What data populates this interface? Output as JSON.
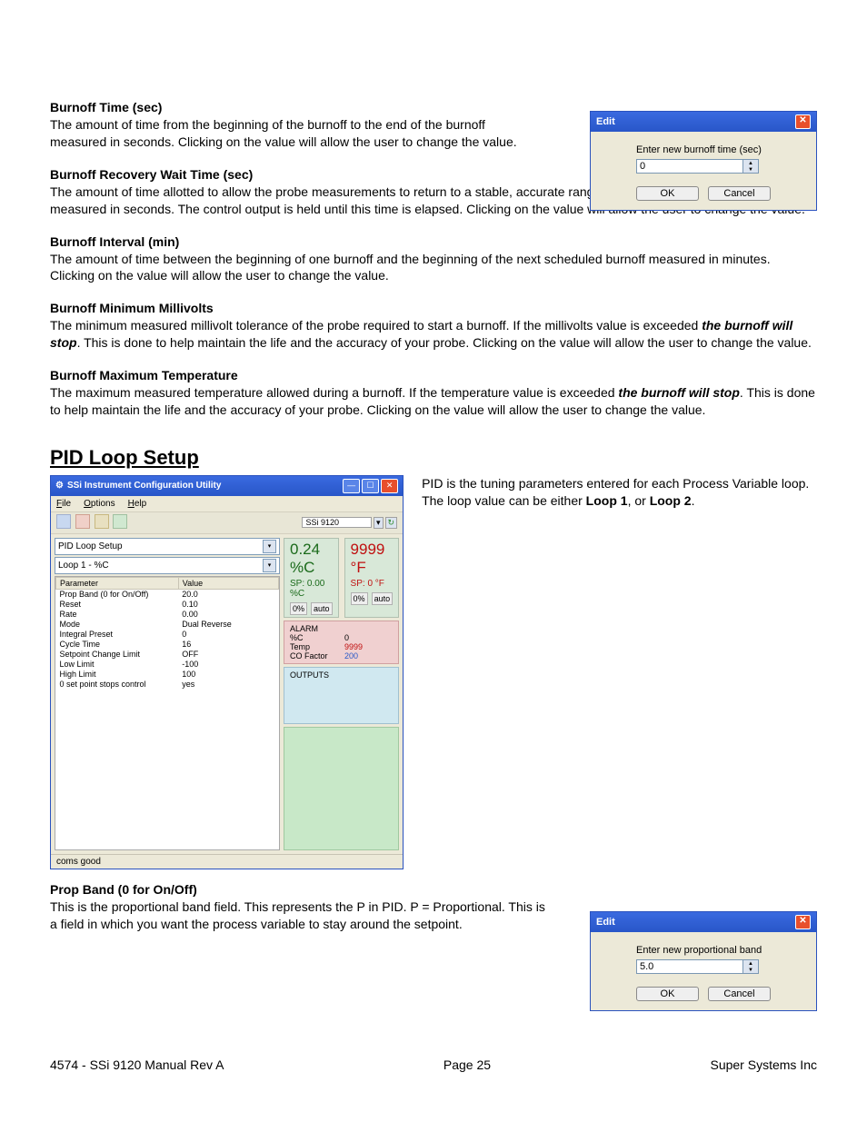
{
  "sections": {
    "burnoff_time": {
      "heading": "Burnoff Time (sec)",
      "text": "The amount of time from the beginning of the burnoff to the end of the burnoff measured in seconds.  Clicking on the value will allow the user to change the value."
    },
    "burnoff_recovery": {
      "heading": "Burnoff Recovery Wait Time (sec)",
      "text": "The amount of time allotted to allow the probe measurements to return to a stable, accurate range after the burnoff is complete. This is measured in seconds. The control output is held until this time is elapsed.  Clicking on the value will allow the user to change the value."
    },
    "burnoff_interval": {
      "heading": "Burnoff Interval (min)",
      "text": "The amount of time between the beginning of one burnoff and the beginning of the next scheduled burnoff measured in minutes.  Clicking on the value will allow the user to change the value."
    },
    "burnoff_min_mv": {
      "heading": "Burnoff Minimum Millivolts",
      "text_1": "The minimum measured millivolt tolerance of the probe required to start a burnoff.  If the millivolts value is exceeded ",
      "text_em": "the burnoff will stop",
      "text_2": ". This is done to help maintain the life and the accuracy of your probe.  Clicking on the value will allow the user to change the value."
    },
    "burnoff_max_temp": {
      "heading": "Burnoff Maximum Temperature",
      "text_1": "The maximum measured temperature allowed during a burnoff. If the temperature value is exceeded ",
      "text_em": "the burnoff will stop",
      "text_2": ". This is done to help maintain the life and the accuracy of your probe.  Clicking on the value will allow the user to change the value."
    },
    "pid_heading": "PID Loop Setup",
    "pid_side": {
      "text_1": "PID is the tuning parameters entered for each Process Variable loop.  The loop value can be either ",
      "loop1": "Loop 1",
      "or": ", or ",
      "loop2": "Loop 2",
      "dot": "."
    },
    "prop_band": {
      "heading": "Prop Band (0 for On/Off)",
      "text": "This is the proportional band field. This represents the P in PID. P = Proportional. This is a field in which you want the process variable to stay around the setpoint."
    }
  },
  "dialog_top": {
    "title": "Edit",
    "label": "Enter new burnoff time (sec)",
    "value": "0",
    "ok": "OK",
    "cancel": "Cancel"
  },
  "dialog_bottom": {
    "title": "Edit",
    "label": "Enter new proportional band",
    "value": "5.0",
    "ok": "OK",
    "cancel": "Cancel"
  },
  "app": {
    "title": "SSi Instrument Configuration Utility",
    "menu": {
      "file": "File",
      "options": "Options",
      "help": "Help"
    },
    "toolbar_model": "SSi 9120",
    "combo1": "PID Loop Setup",
    "combo2": "Loop 1 - %C",
    "table_headers": {
      "param": "Parameter",
      "value": "Value"
    },
    "rows": [
      {
        "p": "Prop Band (0 for On/Off)",
        "v": "20.0"
      },
      {
        "p": "Reset",
        "v": "0.10"
      },
      {
        "p": "Rate",
        "v": "0.00"
      },
      {
        "p": "Mode",
        "v": "Dual Reverse"
      },
      {
        "p": "Integral Preset",
        "v": "0"
      },
      {
        "p": "Cycle Time",
        "v": "16"
      },
      {
        "p": "Setpoint Change Limit",
        "v": "OFF"
      },
      {
        "p": "Low Limit",
        "v": "-100"
      },
      {
        "p": "High Limit",
        "v": "100"
      },
      {
        "p": "0 set point stops control",
        "v": "yes"
      }
    ],
    "pv_c": {
      "val": "0.24 %C",
      "sp": "SP: 0.00 %C",
      "m1": "0%",
      "m2": "auto"
    },
    "pv_f": {
      "val": "9999 °F",
      "sp": "SP: 0 °F",
      "m1": "0%",
      "m2": "auto"
    },
    "alarm": {
      "heading": "ALARM",
      "r1k": "%C",
      "r1v": "0",
      "r2k": "Temp",
      "r2v": "9999",
      "r3k": "CO Factor",
      "r3v": "200"
    },
    "outputs_heading": "OUTPUTS",
    "status": "coms good"
  },
  "footer": {
    "left": "4574 - SSi 9120 Manual Rev A",
    "center": "Page 25",
    "right": "Super Systems Inc"
  }
}
